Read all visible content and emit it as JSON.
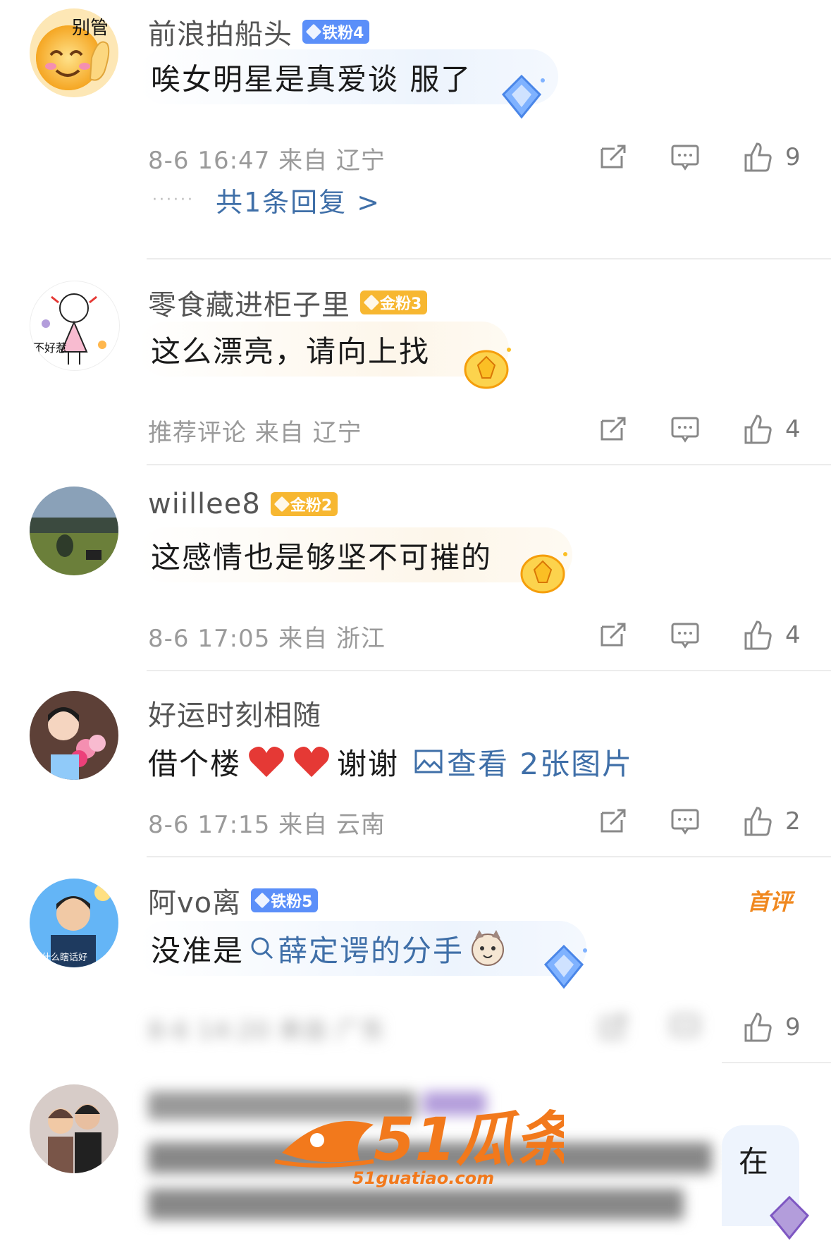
{
  "comments": [
    {
      "username": "前浪拍船头",
      "badge": "铁粉4",
      "avatar_text": "别管",
      "text": "唉女明星是真爱谈 服了",
      "meta": "8-6 16:47  来自 辽宁",
      "likes": "9",
      "replies": "共1条回复 >"
    },
    {
      "username": "零食藏进柜子里",
      "badge": "金粉3",
      "avatar_text": "不好惹",
      "text": "这么漂亮，请向上找",
      "meta": "推荐评论  来自 辽宁",
      "likes": "4"
    },
    {
      "username": "wiillee8",
      "badge": "金粉2",
      "text": "这感情也是够坚不可摧的",
      "meta": "8-6 17:05  来自 浙江",
      "likes": "4"
    },
    {
      "username": "好运时刻相随",
      "text": "借个楼",
      "text_suffix": "谢谢",
      "image_link": "查看 2张图片",
      "meta": "8-6 17:15  来自 云南",
      "likes": "2"
    },
    {
      "username": "阿vo离",
      "badge": "铁粉5",
      "first_tag": "首评",
      "avatar_text": "说什么瞎话好",
      "text": "没准是",
      "search_link": "薛定谔的分手",
      "meta": "8-6 14:20  来自 广东",
      "likes": "9"
    },
    {
      "text_suffix": "在"
    }
  ],
  "watermark": {
    "brand": "51瓜条",
    "url": "51guatiao.com"
  },
  "colors": {
    "link": "#3f6fa8",
    "iron_badge": "#5b8ff9",
    "gold_badge": "#f7b731",
    "first_tag": "#f0881f"
  }
}
